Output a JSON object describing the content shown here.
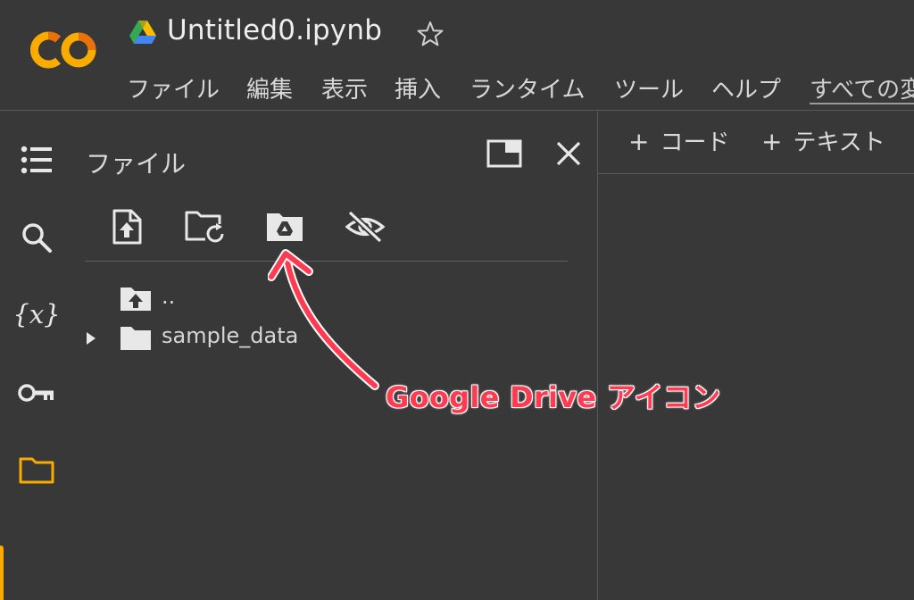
{
  "header": {
    "title": "Untitled0.ipynb",
    "menu": [
      "ファイル",
      "編集",
      "表示",
      "挿入",
      "ランタイム",
      "ツール",
      "ヘルプ",
      "すべての変"
    ]
  },
  "sidebar": {
    "icons": [
      "table-of-contents-icon",
      "search-icon",
      "variables-icon",
      "secrets-key-icon",
      "folder-icon"
    ],
    "variables_label": "{x}",
    "active_accent": "#f9ab00"
  },
  "file_panel": {
    "title": "ファイル",
    "toolbar": [
      "upload-file-icon",
      "refresh-folder-icon",
      "google-drive-folder-icon",
      "hide-files-icon"
    ],
    "tree": [
      {
        "label": ".."
      },
      {
        "label": "sample_data"
      }
    ]
  },
  "notebook_toolbar": {
    "plus": "+",
    "add_code": "コード",
    "add_text": "テキスト"
  },
  "annotation": {
    "label": "Google Drive アイコン",
    "color": "#ff3b52"
  }
}
